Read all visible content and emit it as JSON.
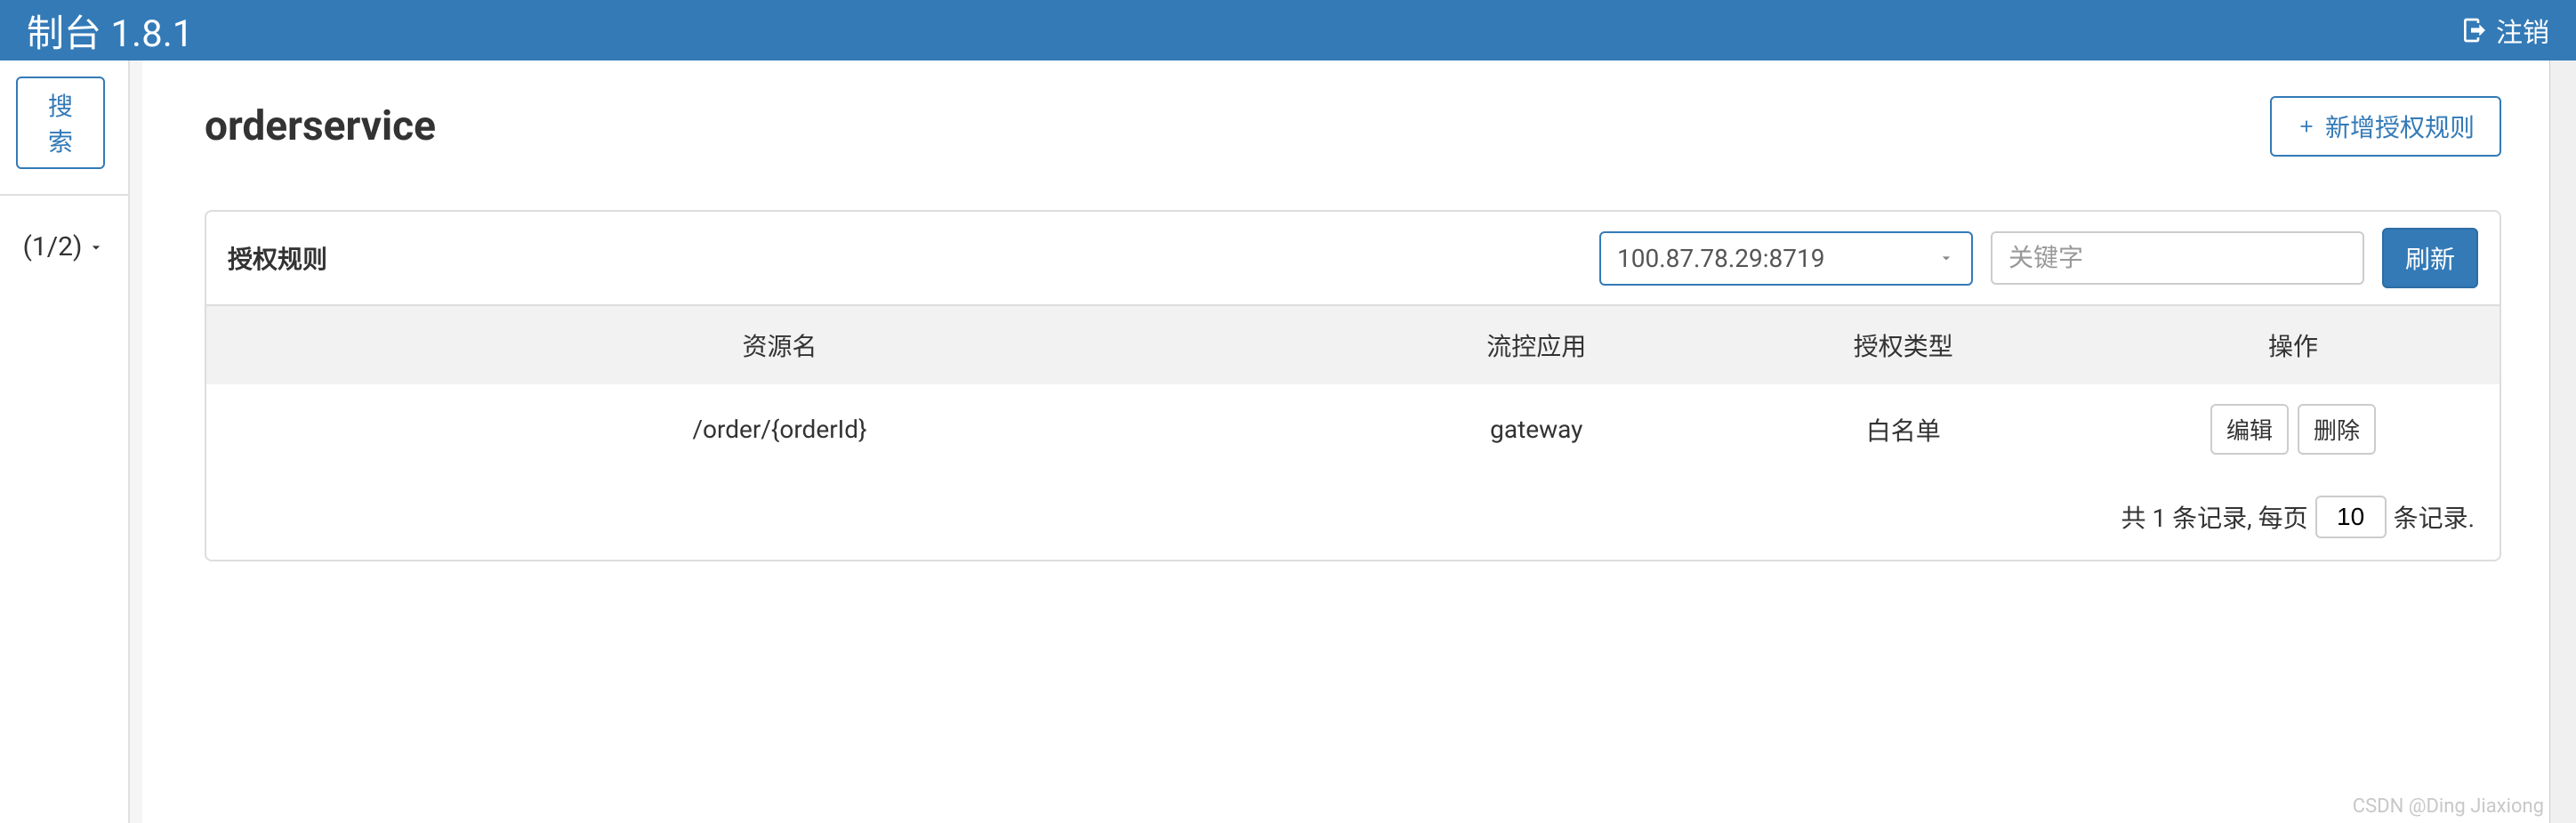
{
  "topbar": {
    "title_fragment": "制台 1.8.1",
    "logout_label": "注销"
  },
  "sidebar": {
    "search_label": "搜索",
    "page_indicator": "(1/2)"
  },
  "page": {
    "title": "orderservice",
    "add_rule_label": "新增授权规则"
  },
  "panel": {
    "title": "授权规则",
    "ip_selected": "100.87.78.29:8719",
    "keyword_placeholder": "关键字",
    "refresh_label": "刷新"
  },
  "table": {
    "columns": {
      "resource": "资源名",
      "limit_app": "流控应用",
      "auth_type": "授权类型",
      "actions": "操作"
    },
    "rows": [
      {
        "resource": "/order/{orderId}",
        "limit_app": "gateway",
        "auth_type": "白名单",
        "edit_label": "编辑",
        "delete_label": "删除"
      }
    ]
  },
  "pagination": {
    "prefix": "共 1 条记录, 每页",
    "page_size": "10",
    "suffix": "条记录."
  },
  "watermark": "CSDN @Ding Jiaxiong"
}
